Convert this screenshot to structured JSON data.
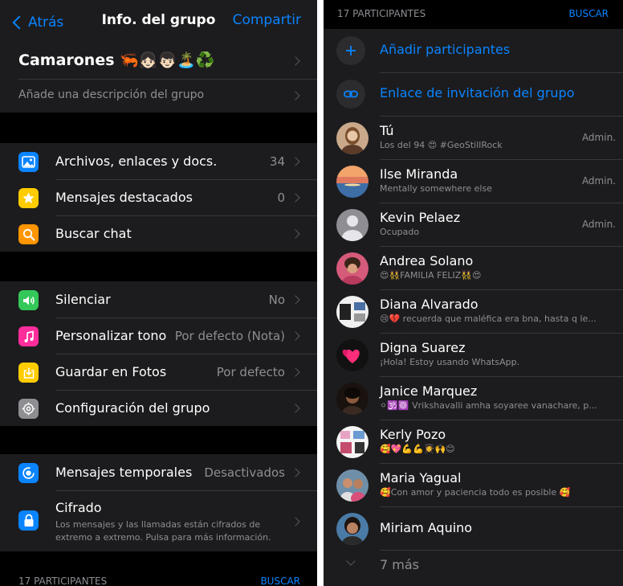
{
  "left": {
    "nav": {
      "back_label": "Atrás",
      "title": "Info. del grupo",
      "share_label": "Compartir"
    },
    "group": {
      "name": "Camarones 🦐👧🏻👦🏻🏝️♻️",
      "description_placeholder": "Añade una descripción del grupo"
    },
    "media_section": [
      {
        "label": "Archivos, enlaces y docs.",
        "value": "34",
        "icon": "photo-icon"
      },
      {
        "label": "Mensajes destacados",
        "value": "0",
        "icon": "star-icon"
      },
      {
        "label": "Buscar chat",
        "value": "",
        "icon": "search-icon"
      }
    ],
    "settings_section": [
      {
        "label": "Silenciar",
        "value": "No",
        "icon": "speaker-icon"
      },
      {
        "label": "Personalizar tono",
        "value": "Por defecto (Nota)",
        "icon": "music-note-icon"
      },
      {
        "label": "Guardar en Fotos",
        "value": "Por defecto",
        "icon": "save-photos-icon"
      },
      {
        "label": "Configuración del grupo",
        "value": "",
        "icon": "gear-icon"
      }
    ],
    "privacy_section": {
      "temporal": {
        "label": "Mensajes temporales",
        "value": "Desactivados",
        "icon": "timer-icon"
      },
      "encryption": {
        "label": "Cifrado",
        "description": "Los mensajes y las llamadas están cifrados de extremo a extremo. Pulsa para más información.",
        "icon": "lock-icon"
      }
    },
    "participants_header": {
      "title": "17 PARTICIPANTES",
      "search_label": "BUSCAR"
    }
  },
  "right": {
    "participants_header": {
      "title": "17 PARTICIPANTES",
      "search_label": "BUSCAR"
    },
    "actions": [
      {
        "label": "Añadir participantes",
        "icon": "plus-icon"
      },
      {
        "label": "Enlace de invitación del grupo",
        "icon": "link-icon"
      }
    ],
    "members": [
      {
        "name": "Tú",
        "status": "Los del 94 😍 #GeoStillRock",
        "role": "Admin."
      },
      {
        "name": "Ilse Miranda",
        "status": "Mentally somewhere else",
        "role": "Admin."
      },
      {
        "name": "Kevin Pelaez",
        "status": "Ocupado",
        "role": "Admin."
      },
      {
        "name": "Andrea Solano",
        "status": "😍👯FAMILIA FELIZ👯😍",
        "role": ""
      },
      {
        "name": "Diana Alvarado",
        "status": "😢💔 recuerda que maléfica era bna, hasta q le...",
        "role": ""
      },
      {
        "name": "Digna Suarez",
        "status": "¡Hola! Estoy usando WhatsApp.",
        "role": ""
      },
      {
        "name": "Janice Marquez",
        "status": "⚪🕉️☸️ Vrikshavalli amha soyaree vanachare, p...",
        "role": ""
      },
      {
        "name": "Kerly Pozo",
        "status": "🥰💖💪💪👩‍🎓🙌😊",
        "role": ""
      },
      {
        "name": "Maria Yagual",
        "status": "🥰Con amor y paciencia todo es posible 🥰",
        "role": ""
      },
      {
        "name": "Miriam Aquino",
        "status": "",
        "role": ""
      }
    ],
    "more_label": "7 más"
  },
  "colors": {
    "accent": "#0a84ff",
    "cell_bg": "#1c1c1e",
    "background": "#000000",
    "secondary_text": "#8e8e93"
  }
}
